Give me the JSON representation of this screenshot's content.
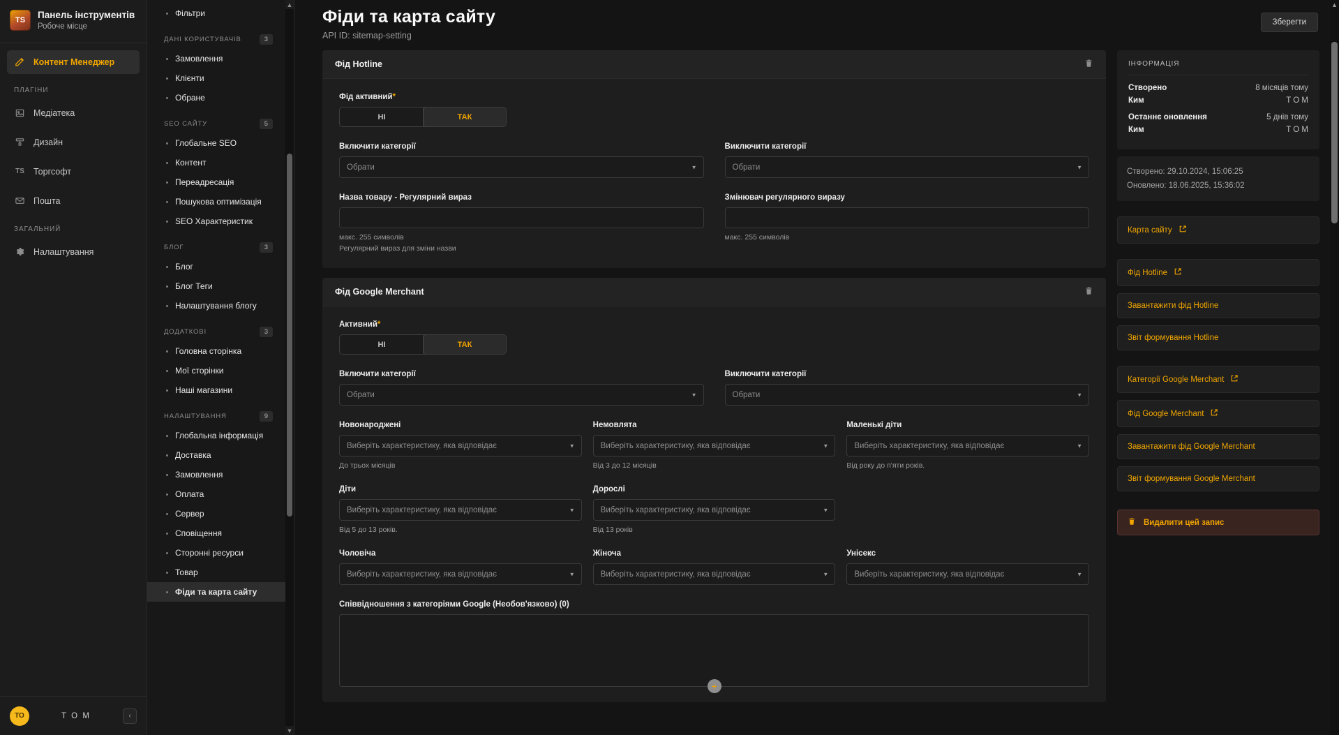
{
  "brand": {
    "logo_text": "TS",
    "title": "Панель інструментів",
    "subtitle": "Робоче місце"
  },
  "sidebar": {
    "active_item": {
      "label": "Контент Менеджер",
      "icon": "edit-pencil-icon"
    },
    "sections": [
      {
        "heading": "ПЛАГІНИ",
        "items": [
          {
            "label": "Медіатека",
            "icon": "media-library-icon"
          },
          {
            "label": "Дизайн",
            "icon": "design-brush-icon"
          },
          {
            "label": "Торгсофт",
            "icon": "torgsoft-icon"
          },
          {
            "label": "Пошта",
            "icon": "mail-icon"
          }
        ]
      },
      {
        "heading": "ЗАГАЛЬНИЙ",
        "items": [
          {
            "label": "Налаштування",
            "icon": "gear-icon"
          }
        ]
      }
    ],
    "footer": {
      "avatar_initials": "ТО",
      "user": "T O M",
      "collapse_icon": "chevron-left-icon"
    }
  },
  "nav2": {
    "top_partial_item": "Фільтри",
    "groups": [
      {
        "heading": "ДАНІ КОРИСТУВАЧІВ",
        "badge": "3",
        "items": [
          "Замовлення",
          "Клієнти",
          "Обране"
        ]
      },
      {
        "heading": "SEO САЙТУ",
        "badge": "5",
        "items": [
          "Глобальне SEO",
          "Контент",
          "Переадресація",
          "Пошукова оптимізація",
          "SEO Характеристик"
        ]
      },
      {
        "heading": "БЛОГ",
        "badge": "3",
        "items": [
          "Блог",
          "Блог Теги",
          "Налаштування блогу"
        ]
      },
      {
        "heading": "ДОДАТКОВІ",
        "badge": "3",
        "items": [
          "Головна сторінка",
          "Мої сторінки",
          "Наші магазини"
        ]
      },
      {
        "heading": "НАЛАШТУВАННЯ",
        "badge": "9",
        "items": [
          "Глобальна інформація",
          "Доставка",
          "Замовлення",
          "Оплата",
          "Сервер",
          "Сповіщення",
          "Сторонні ресурси",
          "Товар",
          "Фіди та карта сайту"
        ]
      }
    ],
    "active_item": "Фіди та карта сайту"
  },
  "header": {
    "title": "Фіди та карта сайту",
    "api_id": "API ID: sitemap-setting",
    "save_label": "Зберегти"
  },
  "hotline_card": {
    "title": "Фід Hotline",
    "delete_icon": "trash-icon",
    "active_label": "Фід активний",
    "required_mark": "*",
    "toggle": {
      "off": "НІ",
      "on": "ТАК",
      "selected": "ТАК"
    },
    "include_label": "Включити категорії",
    "include_value": "Обрати",
    "exclude_label": "Виключити категорії",
    "exclude_value": "Обрати",
    "name_regex_label": "Назва товару - Регулярний вираз",
    "name_regex_value": "",
    "replace_regex_label": "Змінювач регулярного виразу",
    "replace_regex_value": "",
    "hint_max": "макс. 255 символів",
    "hint_regex": "Регулярний вираз для зміни назви"
  },
  "merchant_card": {
    "title": "Фід Google Merchant",
    "delete_icon": "trash-icon",
    "active_label": "Активний",
    "required_mark": "*",
    "toggle": {
      "off": "НІ",
      "on": "ТАК",
      "selected": "ТАК"
    },
    "include_label": "Включити категорії",
    "include_value": "Обрати",
    "exclude_label": "Виключити категорії",
    "exclude_value": "Обрати",
    "attr_placeholder": "Виберіть характеристику, яка відповідає",
    "age_fields": [
      {
        "label": "Новонароджені",
        "hint": "До трьох місяців"
      },
      {
        "label": "Немовлята",
        "hint": "Від 3 до 12 місяців"
      },
      {
        "label": "Маленькі діти",
        "hint": "Від року до п'яти років."
      },
      {
        "label": "Діти",
        "hint": "Від 5 до 13 років."
      },
      {
        "label": "Дорослі",
        "hint": "Від 13 років"
      }
    ],
    "gender_fields": [
      {
        "label": "Чоловіча"
      },
      {
        "label": "Жіноча"
      },
      {
        "label": "Унісекс"
      }
    ],
    "mapping_label": "Співвідношення з категоріями Google (Необов'язково) (0)",
    "mapping_add_icon": "plus-icon"
  },
  "info_panel": {
    "heading": "ІНФОРМАЦІЯ",
    "rows": [
      {
        "key": "Створено",
        "value": "8 місяців тому"
      },
      {
        "key": "Ким",
        "value": "T O M"
      },
      {
        "key": "Останнє оновлення",
        "value": "5 днів тому"
      },
      {
        "key": "Ким",
        "value": "T O M"
      }
    ],
    "dates": [
      "Створено: 29.10.2024, 15:06:25",
      "Оновлено: 18.06.2025, 15:36:02"
    ],
    "links_group_a": [
      {
        "label": "Карта сайту",
        "external": true
      }
    ],
    "links_group_b": [
      {
        "label": "Фід Hotline",
        "external": true
      },
      {
        "label": "Завантажити фід Hotline",
        "external": false
      },
      {
        "label": "Звіт формування Hotline",
        "external": false
      }
    ],
    "links_group_c": [
      {
        "label": "Категорії Google Merchant",
        "external": true
      },
      {
        "label": "Фід Google Merchant",
        "external": true
      },
      {
        "label": "Завантажити фід Google Merchant",
        "external": false
      },
      {
        "label": "Звіт формування Google Merchant",
        "external": false
      }
    ],
    "delete_button": {
      "label": "Видалити цей запис",
      "icon": "trash-icon"
    }
  },
  "colors": {
    "accent": "#f0a500",
    "background": "#141414",
    "card": "#1e1e1e",
    "danger_bg": "#3a2420"
  }
}
